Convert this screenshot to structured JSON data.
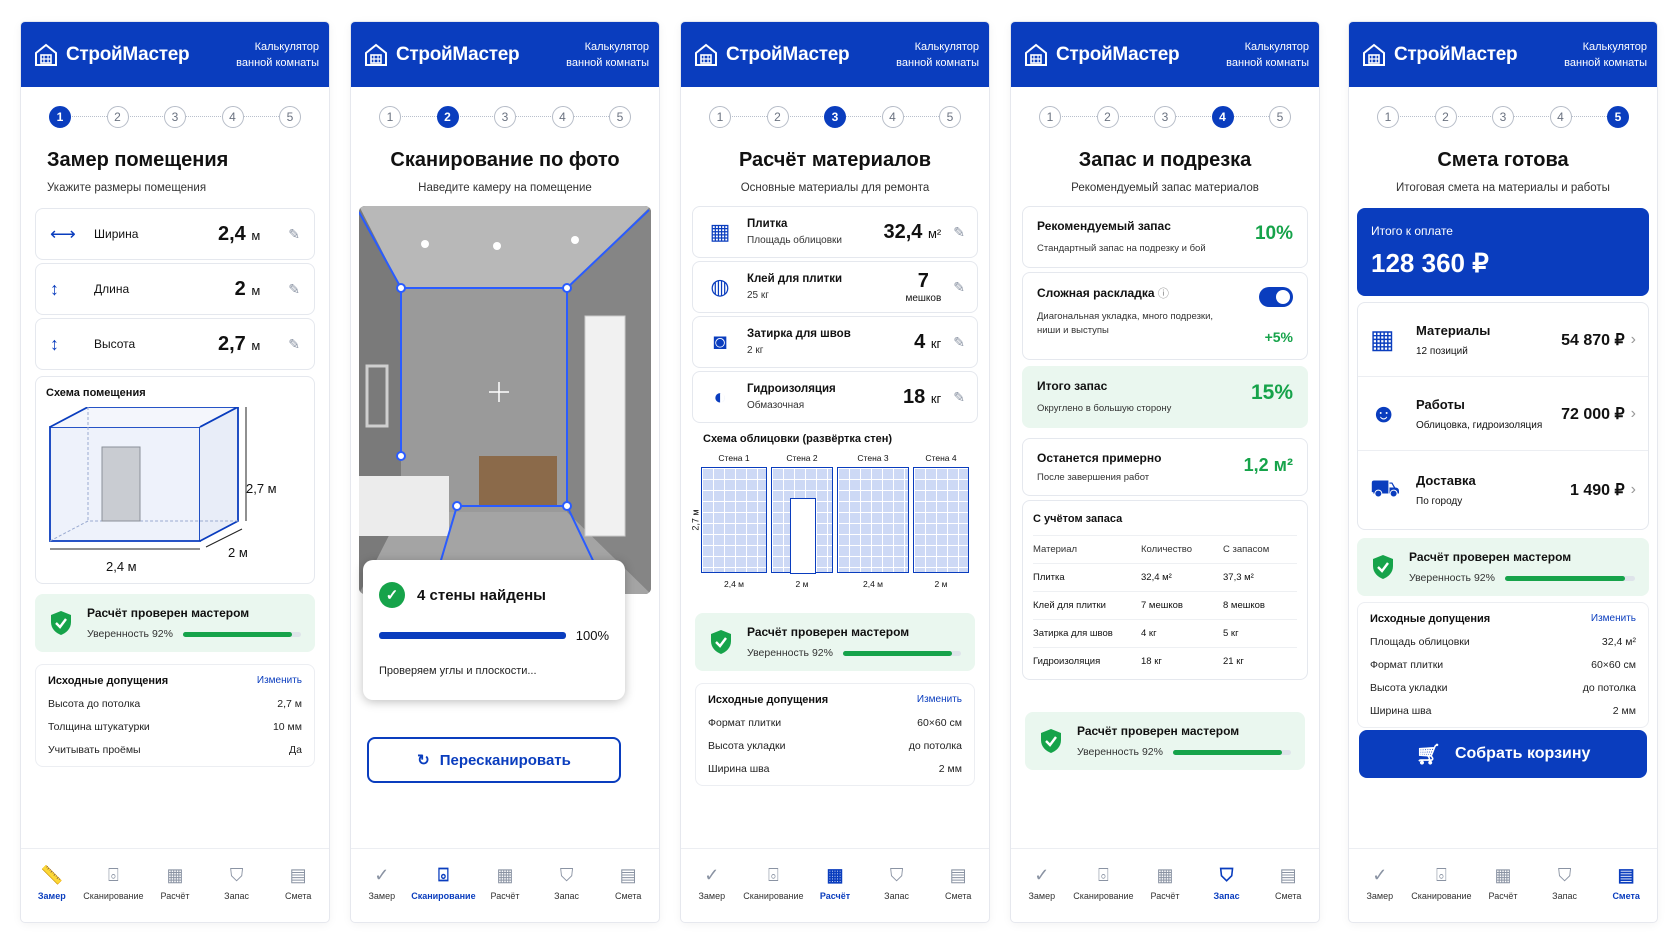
{
  "brand": "СтройМастер",
  "header_sub": "Калькулятор ванной комнаты",
  "steps": [
    "1",
    "2",
    "3",
    "4",
    "5"
  ],
  "nav": [
    "Замер",
    "Сканирование",
    "Расчёт",
    "Запас",
    "Смета"
  ],
  "verify": {
    "title": "Расчёт проверен мастером",
    "conf": "Уверенность 92%",
    "value": 0.92
  },
  "s1": {
    "title": "Замер помещения",
    "sub": "Укажите размеры помещения",
    "rows": [
      {
        "label": "Ширина",
        "value": "2,4",
        "unit": "м"
      },
      {
        "label": "Длина",
        "value": "2",
        "unit": "м"
      },
      {
        "label": "Высота",
        "value": "2,7",
        "unit": "м"
      }
    ],
    "scheme": "Схема помещения",
    "dim_h": "2,7 м",
    "dim_d": "2 м",
    "dim_w": "2,4 м",
    "assume_title": "Исходные допущения",
    "change": "Изменить",
    "assume": [
      {
        "k": "Высота до потолка",
        "v": "2,7 м"
      },
      {
        "k": "Толщина штукатурки",
        "v": "10 мм"
      },
      {
        "k": "Учитывать проёмы",
        "v": "Да"
      }
    ]
  },
  "s2": {
    "title": "Сканирование по фото",
    "sub": "Наведите камеру на помещение",
    "found": "4 стены найдены",
    "pct": "100%",
    "progress": 1.0,
    "checking": "Проверяем углы и плоскости...",
    "rescan": "Пересканировать"
  },
  "s3": {
    "title": "Расчёт материалов",
    "sub": "Основные материалы для ремонта",
    "items": [
      {
        "name": "Плитка",
        "desc": "Площадь облицовки",
        "value": "32,4",
        "unit": "м²",
        "icon": "tile-icon"
      },
      {
        "name": "Клей для плитки",
        "desc": "25 кг",
        "value": "7",
        "unit": "мешков",
        "icon": "bag-icon"
      },
      {
        "name": "Затирка для швов",
        "desc": "2 кг",
        "value": "4",
        "unit": "кг",
        "icon": "bucket-icon"
      },
      {
        "name": "Гидроизоляция",
        "desc": "Обмазочная",
        "value": "18",
        "unit": "кг",
        "icon": "roller-icon"
      }
    ],
    "scheme": "Схема облицовки (развёртка стен)",
    "walls": [
      "Стена 1",
      "Стена 2",
      "Стена 3",
      "Стена 4"
    ],
    "wall_w": [
      "2,4 м",
      "2 м",
      "2,4 м",
      "2 м"
    ],
    "wall_h": "2,7 м",
    "assume_title": "Исходные допущения",
    "change": "Изменить",
    "assume": [
      {
        "k": "Формат плитки",
        "v": "60×60 см"
      },
      {
        "k": "Высота укладки",
        "v": "до потолка"
      },
      {
        "k": "Ширина шва",
        "v": "2 мм"
      }
    ]
  },
  "s4": {
    "title": "Запас и подрезка",
    "sub": "Рекомендуемый запас материалов",
    "rec": {
      "t": "Рекомендуемый запас",
      "s": "Стандартный запас на подрезку и бой",
      "v": "10%"
    },
    "complex": {
      "t": "Сложная раскладка",
      "s": "Диагональная укладка, много подрезки, ниши и выступы",
      "v": "+5%"
    },
    "total": {
      "t": "Итого запас",
      "s": "Округлено в большую сторону",
      "v": "15%"
    },
    "left": {
      "t": "Останется примерно",
      "s": "После завершения работ",
      "v": "1,2 м²"
    },
    "table_title": "С учётом запаса",
    "cols": [
      "Материал",
      "Количество",
      "С запасом"
    ],
    "rows": [
      [
        "Плитка",
        "32,4 м²",
        "37,3 м²"
      ],
      [
        "Клей для плитки",
        "7 мешков",
        "8 мешков"
      ],
      [
        "Затирка для швов",
        "4 кг",
        "5 кг"
      ],
      [
        "Гидроизоляция",
        "18 кг",
        "21 кг"
      ]
    ]
  },
  "s5": {
    "title": "Смета готова",
    "sub": "Итоговая смета на материалы и работы",
    "total_label": "Итого к оплате",
    "total": "128 360 ₽",
    "items": [
      {
        "t": "Материалы",
        "s": "12 позиций",
        "v": "54 870 ₽"
      },
      {
        "t": "Работы",
        "s": "Облицовка, гидроизоляция",
        "v": "72 000 ₽"
      },
      {
        "t": "Доставка",
        "s": "По городу",
        "v": "1 490 ₽"
      }
    ],
    "assume_title": "Исходные допущения",
    "change": "Изменить",
    "assume": [
      {
        "k": "Площадь облицовки",
        "v": "32,4 м²"
      },
      {
        "k": "Формат плитки",
        "v": "60×60 см"
      },
      {
        "k": "Высота укладки",
        "v": "до потолка"
      },
      {
        "k": "Ширина шва",
        "v": "2 мм"
      }
    ],
    "cta": "Собрать корзину"
  },
  "colors": {
    "primary": "#0a3dbe",
    "success": "#16a34a"
  }
}
